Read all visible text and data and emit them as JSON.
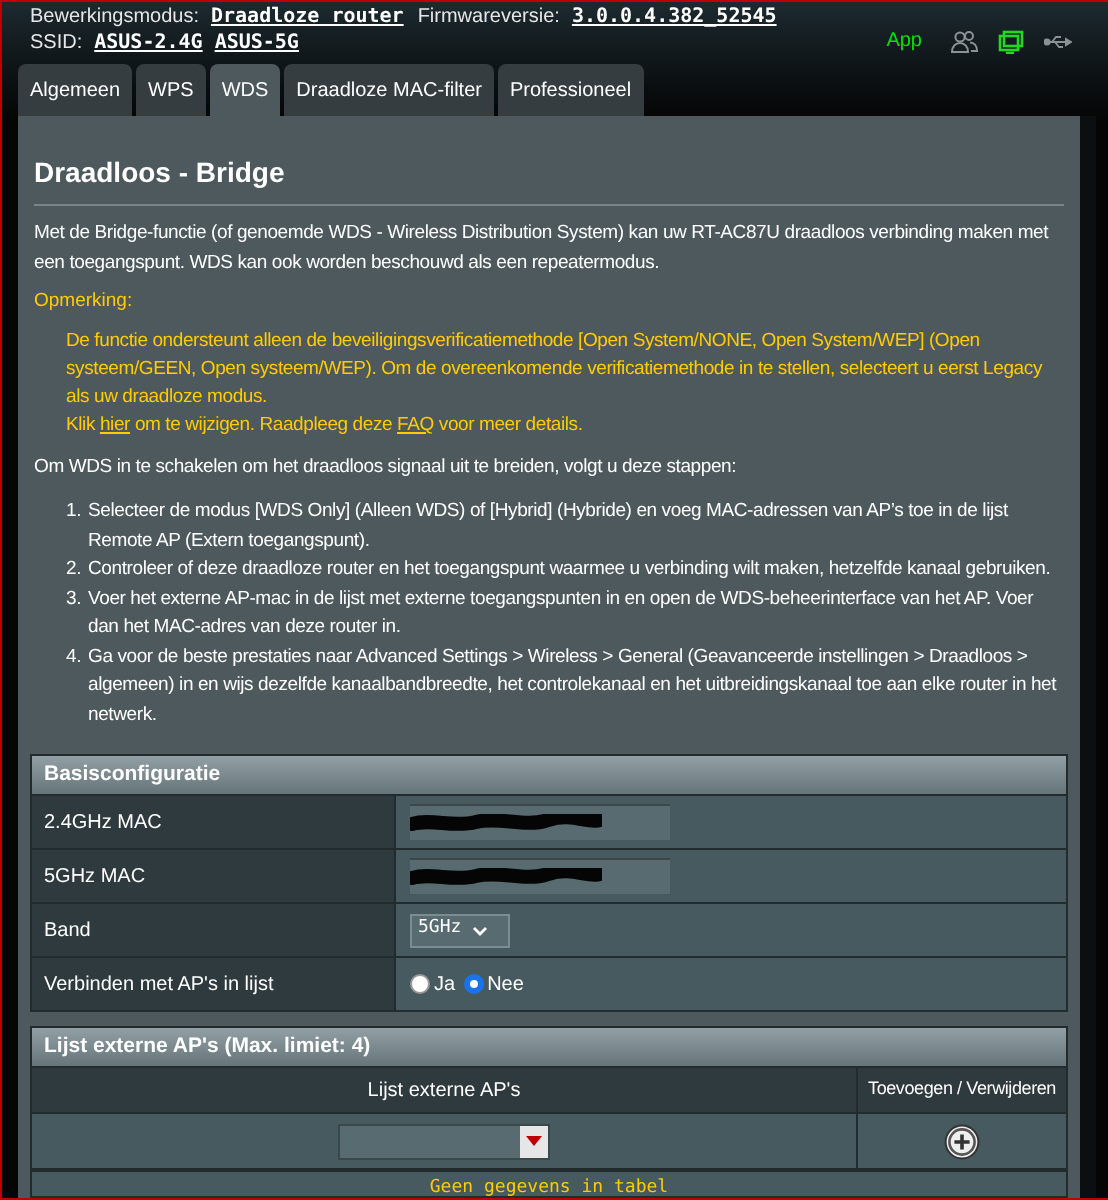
{
  "header": {
    "mode_label": "Bewerkingsmodus:",
    "mode_value": "Draadloze router",
    "firmware_label": "Firmwareversie:",
    "firmware_value": "3.0.0.4.382_52545",
    "ssid_label": "SSID:",
    "ssids": [
      "ASUS-2.4G",
      "ASUS-5G"
    ],
    "app_label": "App"
  },
  "tabs": [
    {
      "label": "Algemeen",
      "selected": false
    },
    {
      "label": "WPS",
      "selected": false
    },
    {
      "label": "WDS",
      "selected": true
    },
    {
      "label": "Draadloze MAC-filter",
      "selected": false
    },
    {
      "label": "Professioneel",
      "selected": false
    }
  ],
  "title": "Draadloos - Bridge",
  "intro": "Met de Bridge-functie (of genoemde WDS - Wireless Distribution System) kan uw RT-AC87U draadloos verbinding maken met een toegangspunt. WDS kan ook worden beschouwd als een repeatermodus.",
  "note_heading": "Opmerking:",
  "note_text": "De functie ondersteunt alleen de beveiligingsverificatiemethode [Open System/NONE, Open System/WEP] (Open systeem/GEEN, Open systeem/WEP). Om de overeenkomende verificatiemethode in te stellen, selecteert u eerst Legacy als uw draadloze modus.",
  "note_links": [
    "Klik ",
    "hier",
    " om te wijzigen. Raadpleeg deze ",
    "FAQ",
    " voor meer details."
  ],
  "steps_intro": "Om WDS in te schakelen om het draadloos signaal uit te breiden, volgt u deze stappen:",
  "steps": [
    {
      "number": "1.",
      "text": "Selecteer de modus [WDS Only] (Alleen WDS) of [Hybrid] (Hybride) en voeg MAC-adressen van AP’s toe in de lijst Remote AP (Extern toegangspunt)."
    },
    {
      "number": "2.",
      "text": "Controleer of deze draadloze router en het toegangspunt waarmee u verbinding wilt maken, hetzelfde kanaal gebruiken."
    },
    {
      "number": "3.",
      "text": "Voer het externe AP-mac in de lijst met externe toegangspunten in en open de WDS-beheerinterface van het AP. Voer dan het MAC-adres van deze router in."
    },
    {
      "number": "4.",
      "text": "Ga voor de beste prestaties naar Advanced Settings > Wireless > General (Geavanceerde instellingen > Draadloos > algemeen) in en wijs dezelfde kanaalbandbreedte, het controlekanaal en het uitbreidingskanaal toe aan elke router in het netwerk."
    }
  ],
  "basic_config": {
    "title": "Basisconfiguratie",
    "rows": [
      {
        "kind": "redacted",
        "label": "2.4GHz MAC"
      },
      {
        "kind": "redacted",
        "label": "5GHz MAC"
      },
      {
        "kind": "select",
        "label": "Band",
        "value": "5GHz"
      },
      {
        "kind": "radio",
        "label": "Verbinden met AP's in lijst",
        "options": [
          {
            "label": "Ja",
            "selected": false
          },
          {
            "label": "Nee",
            "selected": true
          }
        ]
      }
    ]
  },
  "remote_ap": {
    "title": "Lijst externe AP's (Max. limiet: 4)",
    "columns": [
      "Lijst externe AP's",
      "Toevoegen / Verwijderen"
    ],
    "empty_text": "Geen gegevens in tabel"
  }
}
